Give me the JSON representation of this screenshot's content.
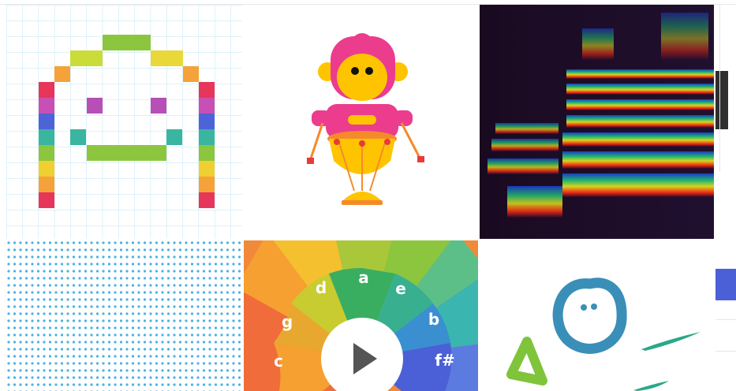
{
  "experiments": [
    {
      "id": "pixel-face",
      "icon": "pixel-rainbow-face-icon"
    },
    {
      "id": "monkey",
      "icon": "drumming-monkey-icon"
    },
    {
      "id": "spectrogram",
      "icon": "spectrogram-icon"
    },
    {
      "id": "dots",
      "icon": "dot-grid-icon"
    },
    {
      "id": "wheel",
      "icon": "chord-wheel-icon"
    },
    {
      "id": "drawing",
      "icon": "doodle-face-icon"
    }
  ],
  "wheel": {
    "notes": [
      "a",
      "d",
      "e",
      "g",
      "b",
      "c",
      "f#"
    ],
    "play_icon": "play-icon"
  },
  "colors": {
    "grid_line": "#bfe6f5",
    "dots": "#49b3e0",
    "monkey_pink": "#ec3c8e",
    "drum_yellow": "#ffc400",
    "kanji_blue": "#3a8fb8",
    "kanji_green": "#7fc43b",
    "accent_blue": "#4b5fd6"
  }
}
